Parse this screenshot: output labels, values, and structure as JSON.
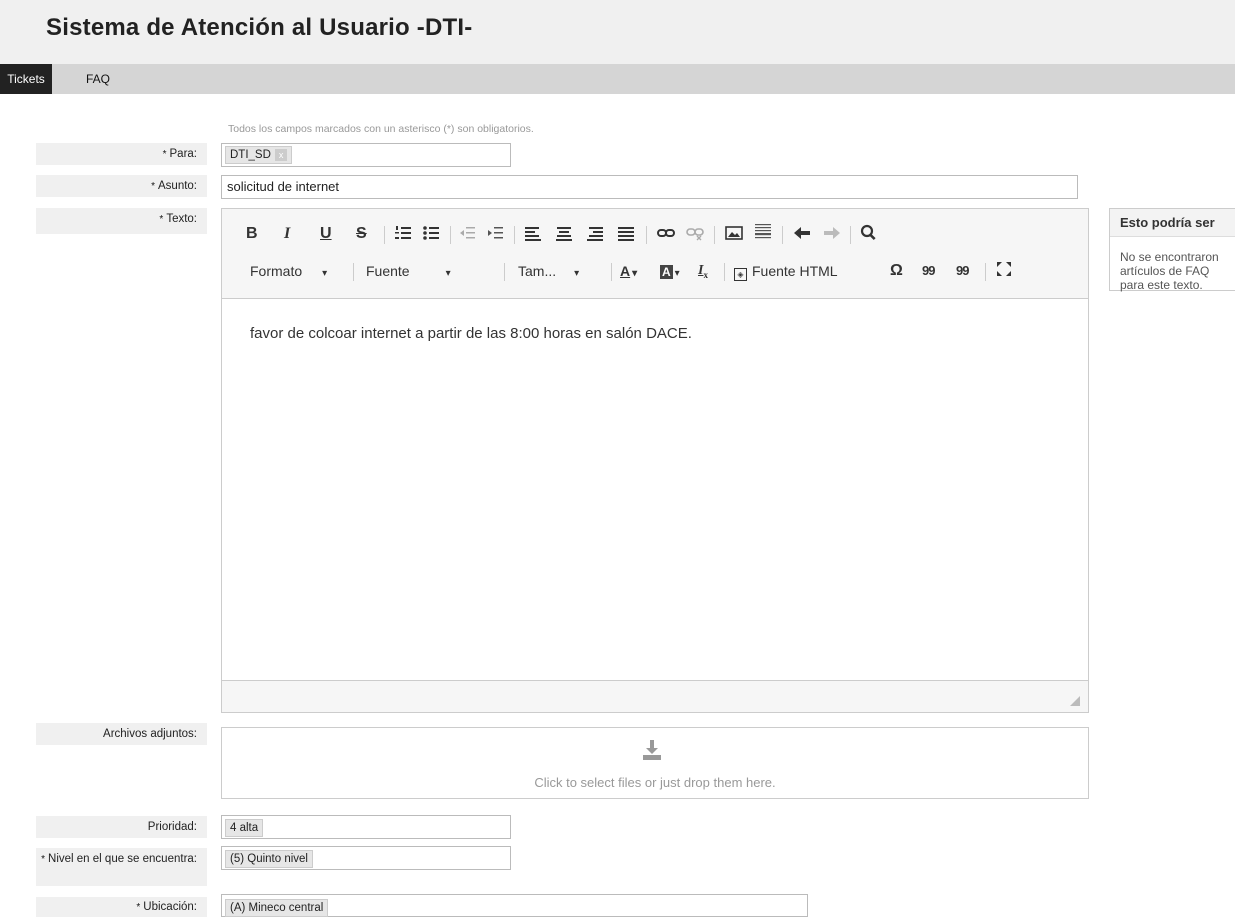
{
  "header": {
    "title": "Sistema de Atención al Usuario -DTI-"
  },
  "nav": {
    "tabs": [
      {
        "label": "Tickets"
      },
      {
        "label": "FAQ"
      }
    ]
  },
  "form": {
    "hint": "Todos los campos marcados con un asterisco (*) son obligatorios.",
    "required_mark": "*",
    "para": {
      "label": "Para:",
      "tag": "DTI_SD",
      "remove": "x"
    },
    "asunto": {
      "label": "Asunto:",
      "value": "solicitud de internet"
    },
    "texto": {
      "label": "Texto:"
    },
    "adjuntos": {
      "label": "Archivos adjuntos:",
      "drop_text": "Click to select files or just drop them here."
    },
    "prioridad": {
      "label": "Prioridad:",
      "value": "4 alta"
    },
    "nivel": {
      "label": "Nivel en el que se encuentra:",
      "value": "(5) Quinto nivel"
    },
    "ubicacion": {
      "label": "Ubicación:",
      "value": "(A) Mineco central"
    }
  },
  "editor": {
    "toolbar": {
      "bold": "B",
      "italic": "I",
      "underline": "U",
      "strike": "S",
      "format": "Formato",
      "font": "Fuente",
      "size": "Tam...",
      "source": "Fuente HTML",
      "omega": "Ω",
      "quote_open": "99",
      "quote_close": "99",
      "text_color_letter": "A",
      "bg_color_letter": "A",
      "clear_format_letter": "I"
    },
    "content": "favor de colcoar internet a partir de las 8:00 horas en salón DACE."
  },
  "side": {
    "title": "Esto podría ser",
    "body": "No se encontraron artículos de FAQ para este texto."
  }
}
